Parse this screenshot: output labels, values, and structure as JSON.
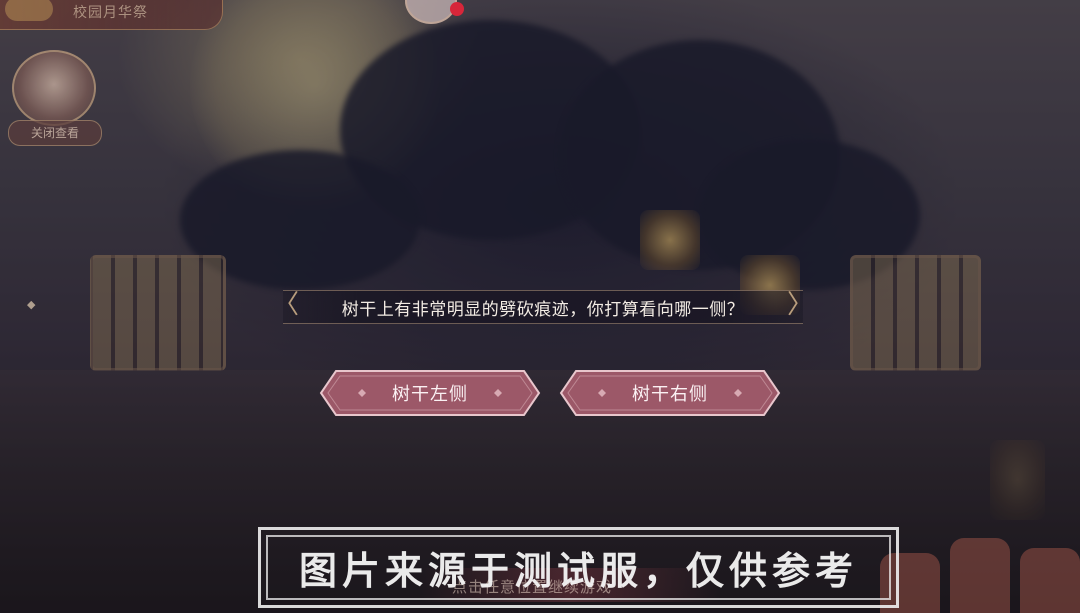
{
  "event_banner": {
    "label": "校园月华祭"
  },
  "avatar_label": "关闭查看",
  "dialog": {
    "question": "树干上有非常明显的劈砍痕迹，你打算看向哪一侧？"
  },
  "choices": [
    {
      "label": "树干左侧"
    },
    {
      "label": "树干右侧"
    }
  ],
  "hint": "点击任意位置继续游戏",
  "watermark": "图片来源于测试服，仅供参考",
  "colors": {
    "choice_fill": "#9c5868",
    "choice_border": "#e8c6cc",
    "question_text": "#f3ece4",
    "notification_dot": "#d7263a"
  }
}
